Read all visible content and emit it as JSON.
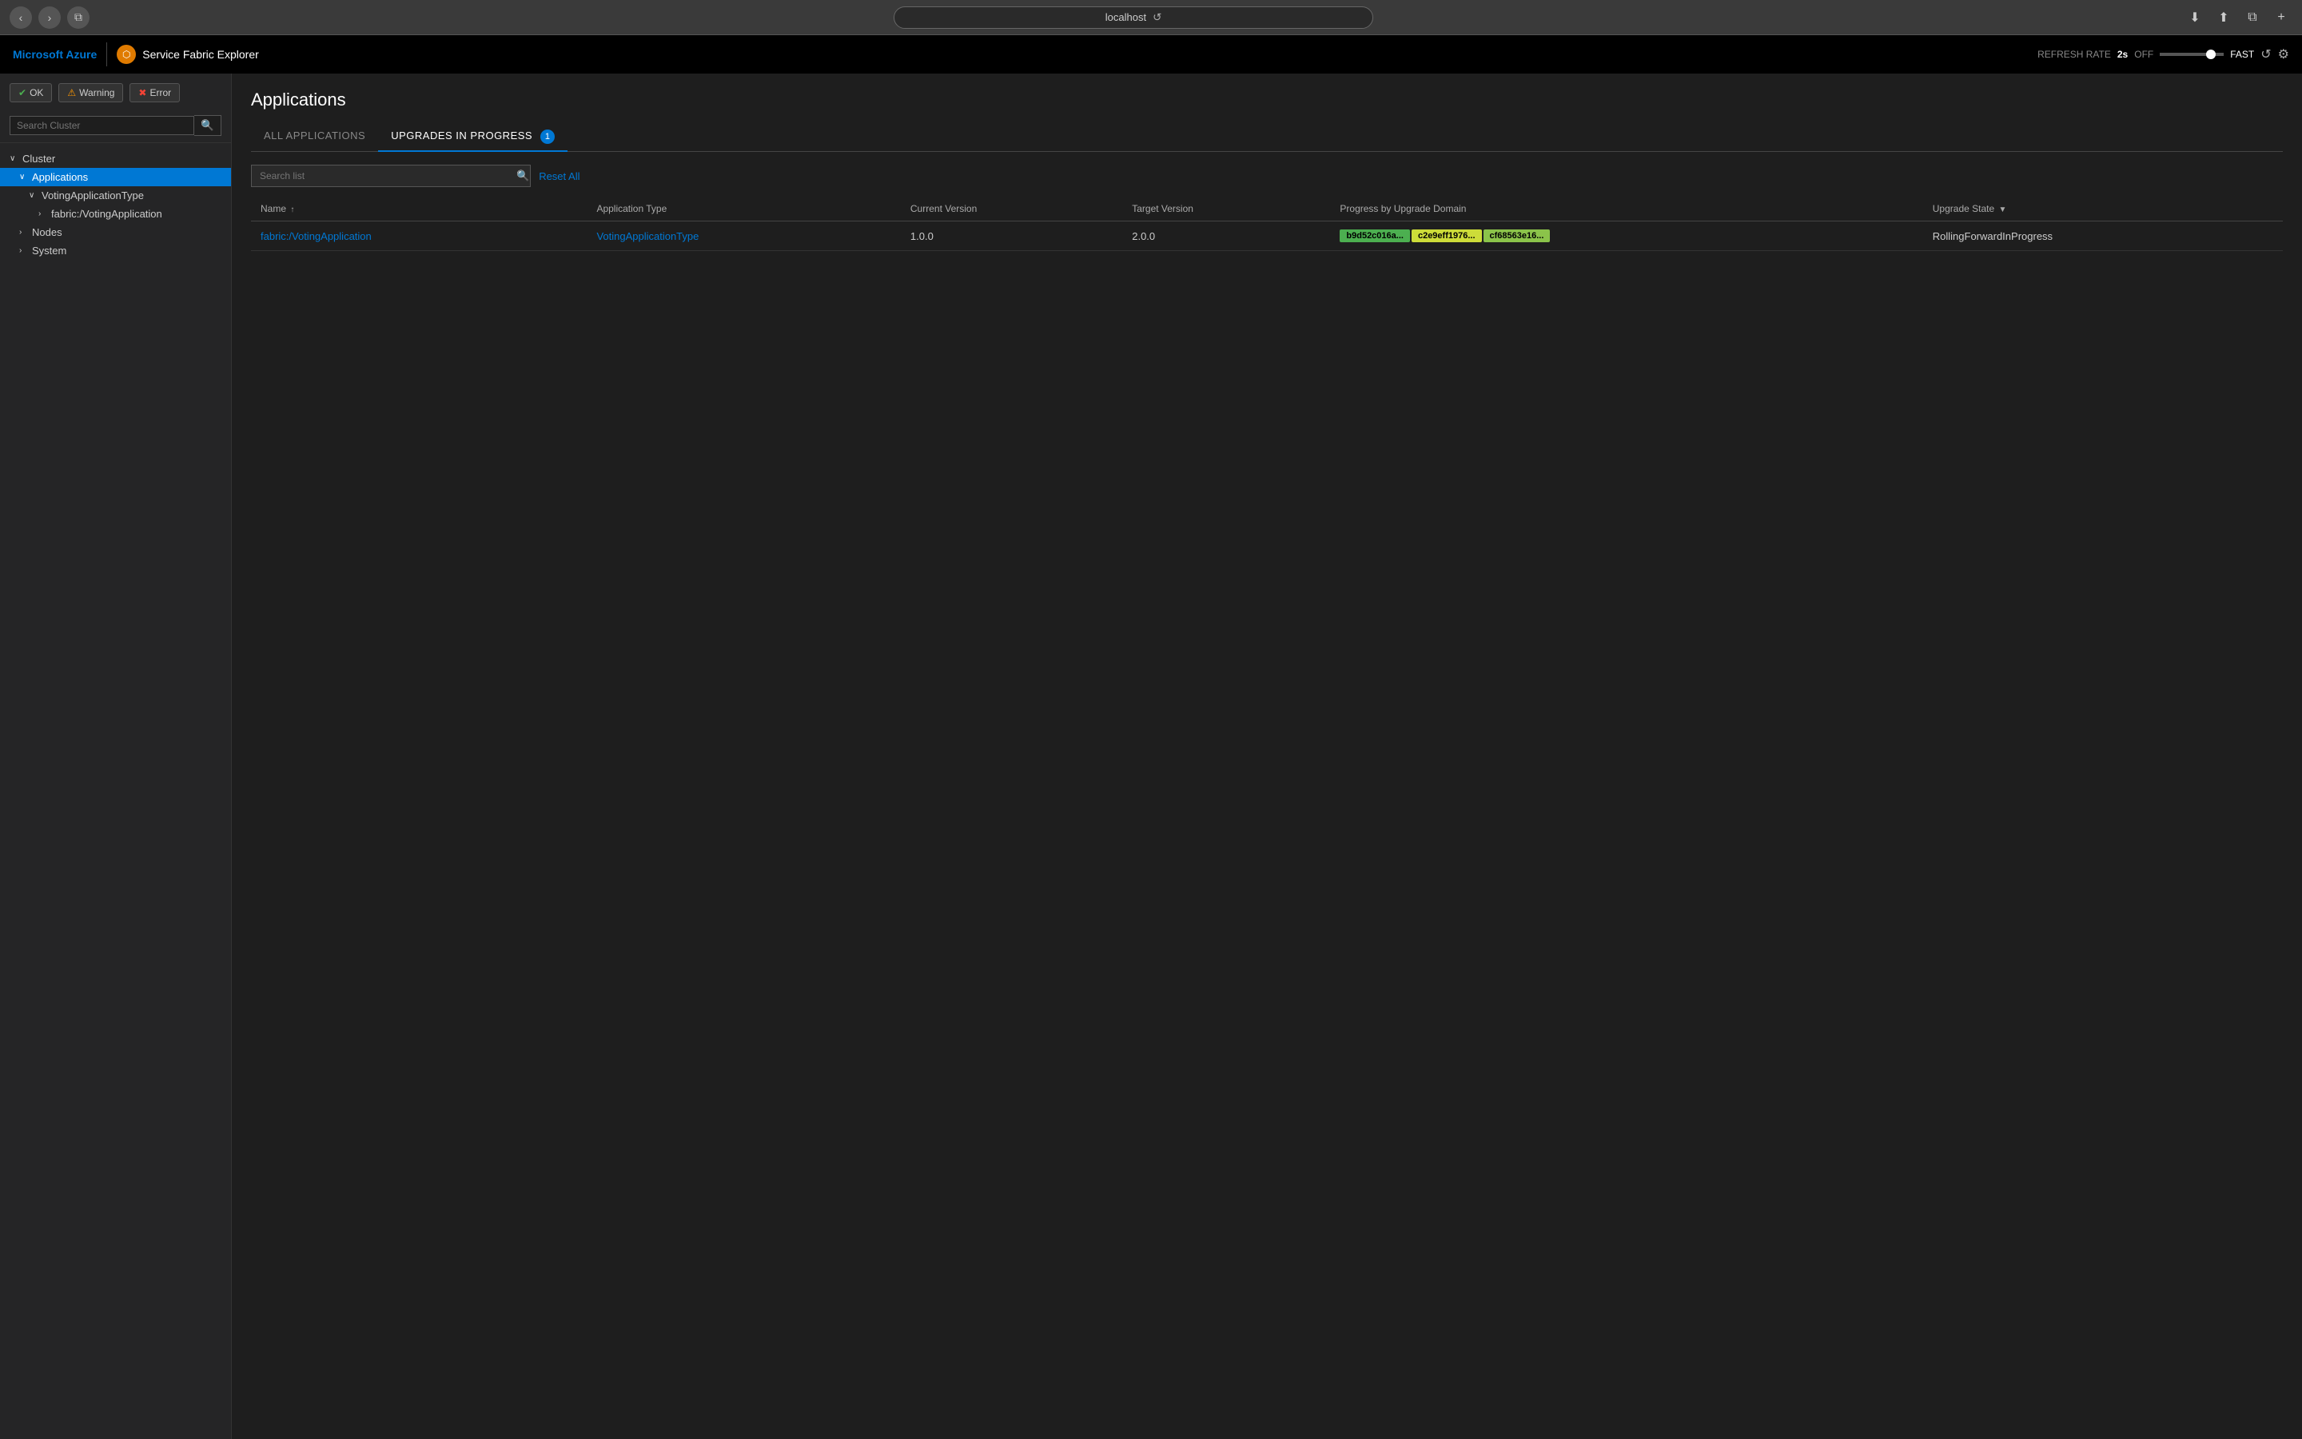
{
  "browser": {
    "url": "localhost",
    "back_label": "‹",
    "forward_label": "›",
    "refresh_label": "↺",
    "tab_label": "⧉"
  },
  "topnav": {
    "azure_label": "Microsoft Azure",
    "app_icon_label": "⬡",
    "app_title": "Service Fabric Explorer",
    "refresh_rate_label": "REFRESH RATE",
    "refresh_rate_value": "2s",
    "refresh_toggle": "OFF",
    "speed_label": "FAST",
    "refresh_icon": "↺",
    "settings_icon": "⚙"
  },
  "sidebar": {
    "status_ok_label": "OK",
    "status_warn_label": "Warning",
    "status_error_label": "Error",
    "search_placeholder": "Search Cluster",
    "tree": [
      {
        "label": "Cluster",
        "level": 0,
        "expanded": true,
        "chevron": "∨"
      },
      {
        "label": "Applications",
        "level": 1,
        "expanded": true,
        "chevron": "∨",
        "active": true
      },
      {
        "label": "VotingApplicationType",
        "level": 2,
        "expanded": true,
        "chevron": "∨"
      },
      {
        "label": "fabric:/VotingApplication",
        "level": 3,
        "expanded": false,
        "chevron": "›"
      },
      {
        "label": "Nodes",
        "level": 1,
        "expanded": false,
        "chevron": "›"
      },
      {
        "label": "System",
        "level": 1,
        "expanded": false,
        "chevron": "›"
      }
    ]
  },
  "main": {
    "page_title": "Applications",
    "tabs": [
      {
        "label": "ALL APPLICATIONS",
        "active": false
      },
      {
        "label": "UPGRADES IN PROGRESS",
        "active": true,
        "badge": "1"
      }
    ],
    "search_placeholder": "Search list",
    "reset_all_label": "Reset All",
    "table": {
      "columns": [
        {
          "label": "Name",
          "sortable": true,
          "sort_icon": "↑"
        },
        {
          "label": "Application Type"
        },
        {
          "label": "Current Version"
        },
        {
          "label": "Target Version"
        },
        {
          "label": "Progress by Upgrade Domain"
        },
        {
          "label": "Upgrade State",
          "filterable": true,
          "filter_icon": "▼"
        }
      ],
      "rows": [
        {
          "name_link": "fabric:/VotingApplication",
          "application_type": "VotingApplicationType",
          "current_version": "1.0.0",
          "target_version": "2.0.0",
          "domains": [
            {
              "label": "b9d52c016a...",
              "color": "green"
            },
            {
              "label": "c2e9eff1976...",
              "color": "yellow"
            },
            {
              "label": "cf68563e16...",
              "color": "lime"
            }
          ],
          "upgrade_state": "RollingForwardInProgress"
        }
      ]
    }
  }
}
